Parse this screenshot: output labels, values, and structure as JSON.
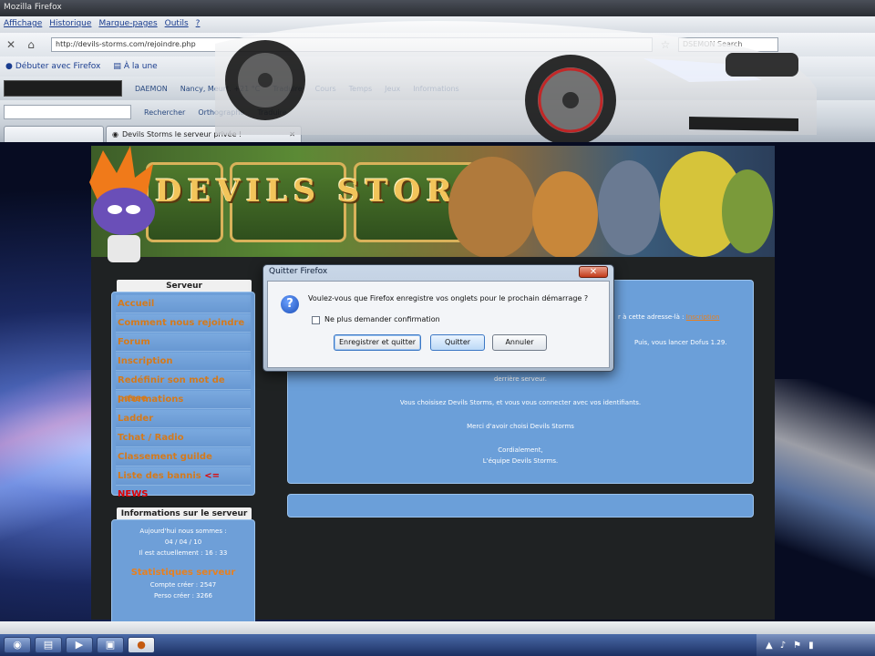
{
  "window": {
    "title": "Mozilla Firefox"
  },
  "menu": [
    "Affichage",
    "Historique",
    "Marque-pages",
    "Outils",
    "?"
  ],
  "nav": {
    "url": "http://devils-storms.com/rejoindre.php",
    "search_placeholder": "DSEMON Search"
  },
  "bookmarks": [
    "Débuter avec Firefox",
    "À la une"
  ],
  "toolbar1": [
    "DAEMON",
    "Nancy, Meurt. +21 °C",
    "Traduire",
    "Cours",
    "Temps",
    "Jeux",
    "Informations"
  ],
  "toolbar2": [
    "Rechercher",
    "Orthographe",
    "Traduire"
  ],
  "tabs": {
    "active": "Devils Storms le serveur privée !"
  },
  "site": {
    "banner_text": "DEVILS STORMS",
    "menu_header": "Serveur",
    "menu": [
      "Accueil",
      "Comment nous rejoindre",
      "Forum",
      "Inscription",
      "Redéfinir son mot de passe",
      "Informations",
      "Ladder",
      "Tchat / Radio",
      "Classement guilde",
      "Liste des bannis"
    ],
    "news_suffix": "<= NEWS",
    "info_header": "Informations sur le serveur",
    "info": {
      "today": "Aujourd'hui nous sommes :",
      "date": "04 / 04 / 10",
      "time": "Il est actuellement : 16 : 33",
      "stats_title": "Statistiques serveur",
      "accounts": "Compte créer : 2547",
      "chars": "Perso créer : 3266"
    },
    "content": {
      "line_right1a": "r à cette adresse-là :",
      "line_right1b": "Inscription",
      "line_right2": "Puis, vous lancer Dofus 1.29.",
      "line3": "derrière serveur.",
      "line4": "Vous choisisez Devils Storms, et vous vous connecter avec vos identifiants.",
      "line5": "Merci d'avoir choisi Devils Storms",
      "line6": "Cordialement,",
      "line7": "L'équipe Devils Storms."
    }
  },
  "dialog": {
    "title": "Quitter Firefox",
    "question": "Voulez-vous que Firefox enregistre vos onglets pour le prochain démarrage ?",
    "checkbox": "Ne plus demander confirmation",
    "save_quit": "Enregistrer et quitter",
    "quit": "Quitter",
    "cancel": "Annuler"
  },
  "colors": {
    "accent_orange": "#d47a1c",
    "panel_blue": "#6e9fd8",
    "news_red": "#e00000"
  }
}
